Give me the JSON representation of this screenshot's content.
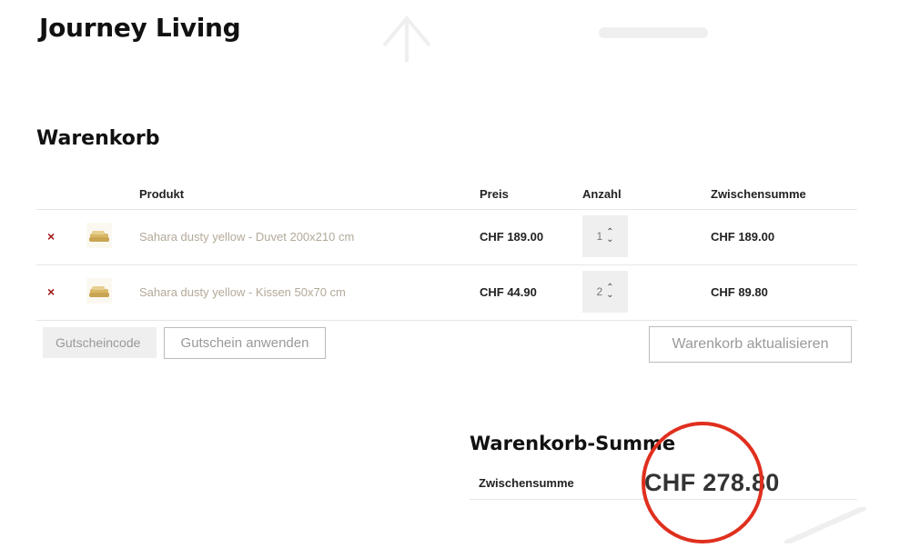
{
  "header": {
    "logo": "Journey Living"
  },
  "page_title": "Warenkorb",
  "table": {
    "headers": {
      "product": "Produkt",
      "price": "Preis",
      "quantity": "Anzahl",
      "subtotal": "Zwischensumme"
    },
    "rows": [
      {
        "remove": "×",
        "name": "Sahara dusty yellow - Duvet 200x210 cm",
        "price": "CHF 189.00",
        "quantity": "1",
        "subtotal": "CHF 189.00"
      },
      {
        "remove": "×",
        "name": "Sahara dusty yellow - Kissen 50x70 cm",
        "price": "CHF 44.90",
        "quantity": "2",
        "subtotal": "CHF 89.80"
      }
    ]
  },
  "coupon": {
    "placeholder": "Gutscheincode",
    "apply_label": "Gutschein anwenden"
  },
  "update_label": "Warenkorb aktualisieren",
  "totals": {
    "title": "Warenkorb-Summe",
    "subtotal_label": "Zwischensumme",
    "subtotal_value": "CHF 278.80"
  },
  "colors": {
    "remove": "#a01818",
    "highlight": "#e02f1e",
    "product_link": "#b3a999"
  }
}
